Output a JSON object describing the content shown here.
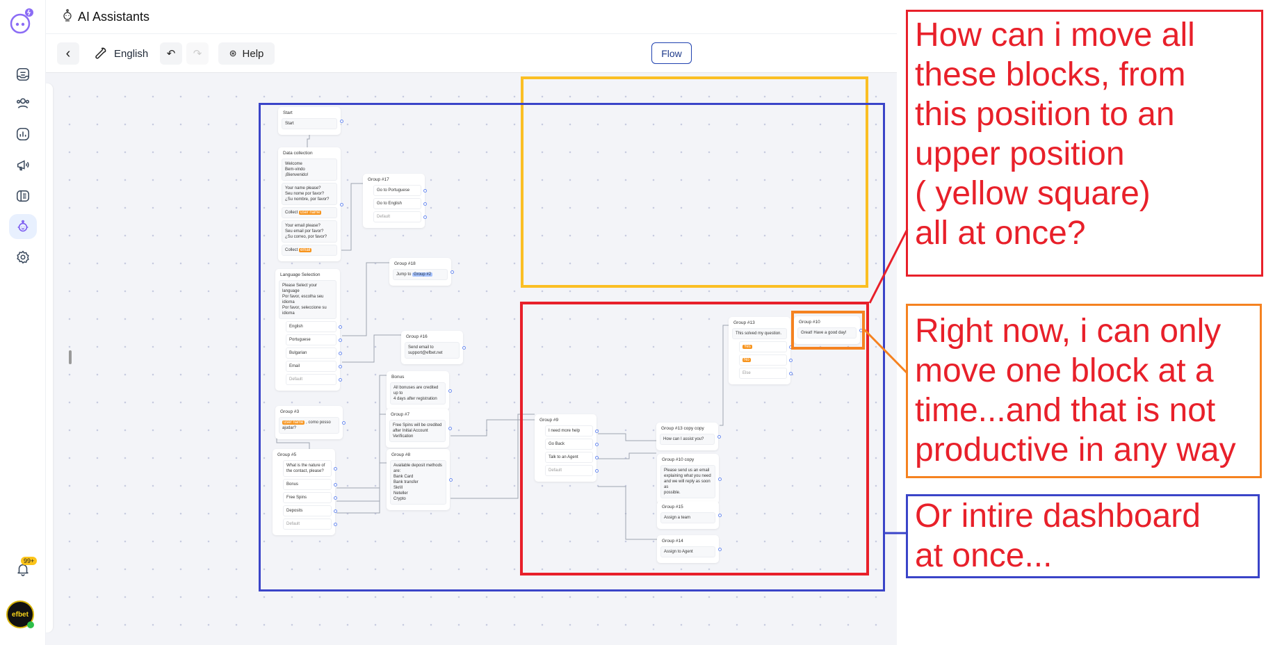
{
  "header": {
    "title": "AI Assistants"
  },
  "toolbar": {
    "language": "English",
    "help": "Help",
    "flow": "Flow"
  },
  "sidebar": {
    "items": [
      "inbox-icon",
      "contacts-icon",
      "reports-icon",
      "broadcast-icon",
      "knowledge-icon",
      "ai-assistant-icon",
      "settings-icon"
    ],
    "active": "ai-assistant-icon",
    "notification_badge": "99+",
    "avatar_text": "efbet"
  },
  "colors": {
    "accent": "#7c5cf0",
    "annotation_red": "#e8202a",
    "annotation_yellow": "#fbbf24",
    "annotation_orange": "#f58220",
    "annotation_blue": "#3a44c8",
    "tag_orange": "#f7941d"
  },
  "nodes": [
    {
      "title": "Start",
      "items": [
        {
          "text": "Start"
        }
      ]
    },
    {
      "title": "Data collection",
      "items": [
        {
          "text": "Welcome\nBem-vindo\n¡Bienvenido!"
        },
        {
          "text": "Your name please?\nSeu nome por favor?\n¿Su nombre, por favor?"
        },
        {
          "text": "Collect ",
          "tag": "user name"
        },
        {
          "text": "Your email please?\nSeu email por favor?\n¿Su correo, por favor?"
        },
        {
          "text": "Collect ",
          "tag": "email"
        }
      ]
    },
    {
      "title": "Group #17",
      "items": [
        {
          "text": "Go to Portuguese",
          "kind": "choice"
        },
        {
          "text": "Go to English",
          "kind": "choice"
        },
        {
          "text": "Default",
          "kind": "def"
        }
      ]
    },
    {
      "title": "Group #18",
      "items": [
        {
          "text": "Jump to ",
          "tag": "Group #2",
          "tagColor": "blue"
        }
      ]
    },
    {
      "title": "Language Selection",
      "items": [
        {
          "text": "Please Select your language\nPor favor, escolha seu\nidioma\nPor favor, seleccione su\nidioma"
        },
        {
          "text": "English",
          "kind": "choice"
        },
        {
          "text": "Portuguese",
          "kind": "choice"
        },
        {
          "text": "Bulgarian",
          "kind": "choice"
        },
        {
          "text": "Email",
          "kind": "choice"
        },
        {
          "text": "Default",
          "kind": "def"
        }
      ]
    },
    {
      "title": "Group #16",
      "items": [
        {
          "text": "Send email to\nsupport@efbet.net"
        }
      ]
    },
    {
      "title": "Bonus",
      "items": [
        {
          "text": "All bonuses are credited up to\n4 days after registration"
        }
      ]
    },
    {
      "title": "Group #7",
      "items": [
        {
          "text": "Free Spins will be credited\nafter Initial Account\nVerification"
        }
      ]
    },
    {
      "title": "Group #3",
      "items": [
        {
          "tag": "user name",
          "text": " , como posso\najudar?"
        }
      ]
    },
    {
      "title": "Group #5",
      "items": [
        {
          "text": "What is the nature of\nthe contact, please?",
          "kind": "choice"
        },
        {
          "text": "Bonus",
          "kind": "choice"
        },
        {
          "text": "Free Spins",
          "kind": "choice"
        },
        {
          "text": "Deposits",
          "kind": "choice"
        },
        {
          "text": "Default",
          "kind": "def"
        }
      ]
    },
    {
      "title": "Group #8",
      "items": [
        {
          "text": "Available deposit methods\nare:\nBank Card\nBank transfer\nSkrill\nNeteller\nCrypto"
        }
      ]
    },
    {
      "title": "Group #9",
      "items": [
        {
          "text": "I need more help",
          "kind": "choice"
        },
        {
          "text": "Go Back",
          "kind": "choice"
        },
        {
          "text": "Talk to an Agent",
          "kind": "choice"
        },
        {
          "text": "Default",
          "kind": "def"
        }
      ]
    },
    {
      "title": "Group #13 copy copy",
      "items": [
        {
          "text": "How can I assist you?"
        }
      ]
    },
    {
      "title": "Group #10 copy",
      "items": [
        {
          "text": "Please send us an email\nexplaining what you need\nand we will reply as soon as\npossible."
        }
      ]
    },
    {
      "title": "Group #15",
      "items": [
        {
          "text": "Assign a team"
        }
      ]
    },
    {
      "title": "Group #14",
      "items": [
        {
          "text": "Assign to Agent"
        }
      ]
    },
    {
      "title": "Group #13",
      "items": [
        {
          "text": "This solved my question."
        },
        {
          "text": "",
          "tag": "Yes",
          "kind": "choice"
        },
        {
          "text": "",
          "tag": "No",
          "kind": "choice"
        },
        {
          "text": "Else",
          "kind": "def"
        }
      ]
    },
    {
      "title": "Group #10",
      "items": [
        {
          "text": "Great! Have a good day!"
        }
      ]
    }
  ],
  "annotations": {
    "question": [
      "How can i move all",
      "these blocks, from",
      "this position to an",
      "upper position",
      "( yellow square)",
      "all at once?"
    ],
    "problem": [
      "Right now, i can only",
      "move one block at a",
      "time...and that is not",
      "productive in any way"
    ],
    "alternative": [
      "Or intire dashboard",
      "at once..."
    ]
  }
}
